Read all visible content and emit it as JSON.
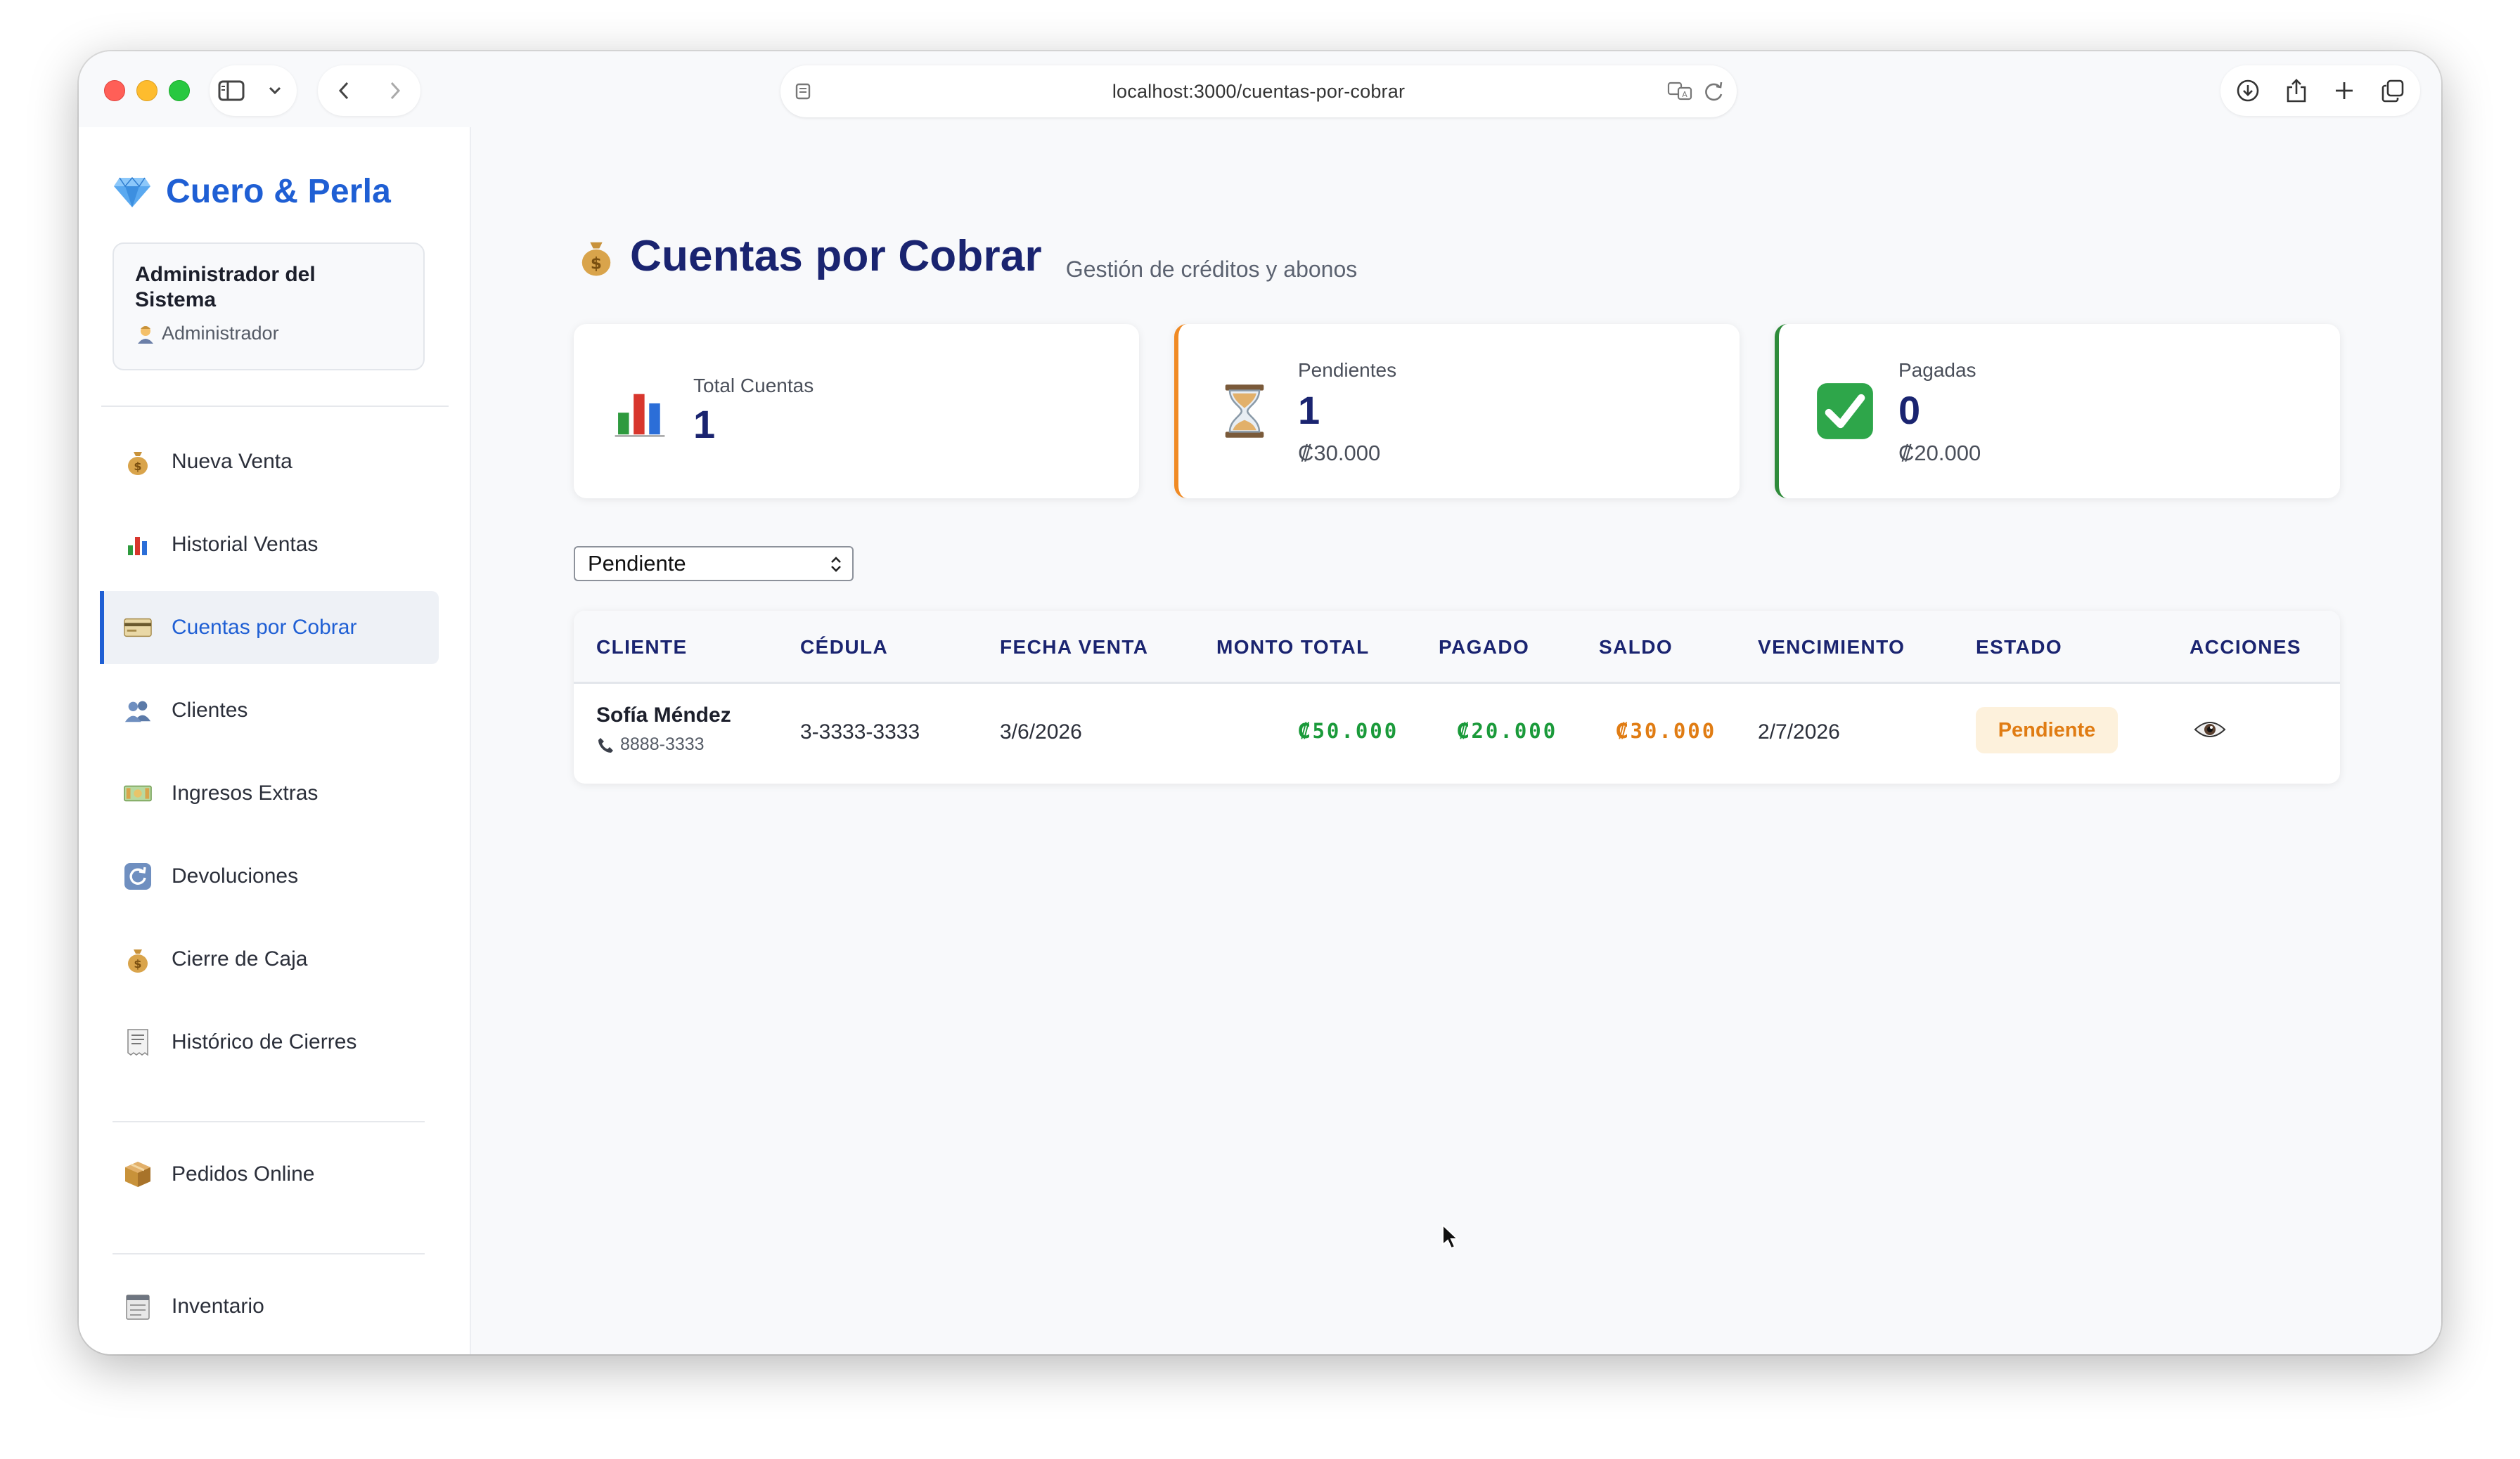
{
  "browser": {
    "url": "localhost:3000/cuentas-por-cobrar"
  },
  "sidebar": {
    "brand": "Cuero & Perla",
    "user": {
      "name": "Administrador del Sistema",
      "role": "Administrador"
    },
    "items": [
      {
        "label": "Nueva Venta",
        "icon": "money-bag-icon"
      },
      {
        "label": "Historial Ventas",
        "icon": "bar-chart-icon"
      },
      {
        "label": "Cuentas por Cobrar",
        "icon": "credit-card-icon",
        "active": true
      },
      {
        "label": "Clientes",
        "icon": "users-icon"
      },
      {
        "label": "Ingresos Extras",
        "icon": "cash-icon"
      },
      {
        "label": "Devoluciones",
        "icon": "refresh-icon"
      },
      {
        "label": "Cierre de Caja",
        "icon": "money-bag-icon"
      },
      {
        "label": "Histórico de Cierres",
        "icon": "receipt-icon"
      },
      {
        "label": "Pedidos Online",
        "icon": "package-icon"
      },
      {
        "label": "Inventario",
        "icon": "clipboard-icon"
      }
    ]
  },
  "page": {
    "title": "Cuentas por Cobrar",
    "subtitle": "Gestión de créditos y abonos"
  },
  "stats": {
    "total": {
      "label": "Total Cuentas",
      "value": "1"
    },
    "pendientes": {
      "label": "Pendientes",
      "value": "1",
      "amount": "₡30.000"
    },
    "pagadas": {
      "label": "Pagadas",
      "value": "0",
      "amount": "₡20.000"
    }
  },
  "filter": {
    "selected": "Pendiente"
  },
  "table": {
    "headers": [
      "CLIENTE",
      "CÉDULA",
      "FECHA VENTA",
      "MONTO TOTAL",
      "PAGADO",
      "SALDO",
      "VENCIMIENTO",
      "ESTADO",
      "ACCIONES"
    ],
    "rows": [
      {
        "cliente": "Sofía Méndez",
        "telefono": "8888-3333",
        "cedula": "3-3333-3333",
        "fecha_venta": "3/6/2026",
        "monto_total": "₡50.000",
        "pagado": "₡20.000",
        "saldo": "₡30.000",
        "vencimiento": "2/7/2026",
        "estado": "Pendiente"
      }
    ]
  },
  "colors": {
    "accent": "#1f5fd4",
    "title": "#1a2470",
    "pending": "#f08a24",
    "paid": "#2e8b3a",
    "money_green": "#1a9a3a",
    "money_orange": "#e07c13"
  }
}
